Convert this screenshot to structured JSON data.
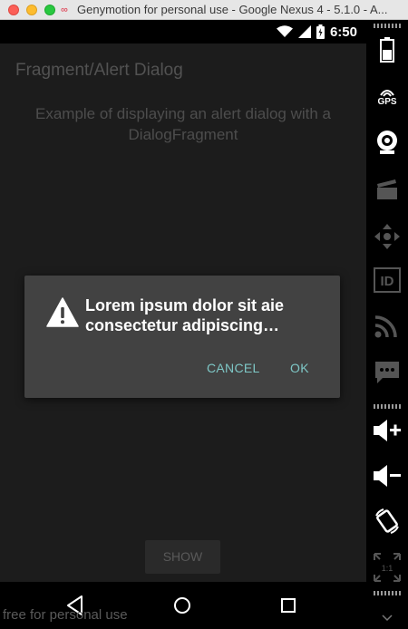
{
  "window": {
    "title": "Genymotion for personal use - Google Nexus 4 - 5.1.0 - A..."
  },
  "status_bar": {
    "time": "6:50",
    "icons": [
      "wifi-icon",
      "signal-icon",
      "battery-charging-icon"
    ]
  },
  "app": {
    "title": "Fragment/Alert Dialog",
    "description": "Example of displaying an alert dialog with a DialogFragment",
    "show_button": "SHOW"
  },
  "dialog": {
    "icon": "warning-icon",
    "message": "Lorem ipsum dolor sit aie consectetur adipiscing…",
    "cancel_label": "CANCEL",
    "ok_label": "OK",
    "accent_color": "#7ec7c6"
  },
  "nav_bar": {
    "buttons": [
      "back-icon",
      "home-icon",
      "recents-icon"
    ],
    "watermark": "free for personal use"
  },
  "sidebar": {
    "gps_label": "GPS",
    "id_label": "ID",
    "pixel_label": "1:1",
    "tools": [
      "battery",
      "gps",
      "camera",
      "video-capture",
      "dpad",
      "device-id",
      "network",
      "sms",
      "volume-up",
      "volume-down",
      "rotate",
      "pixel-perfect"
    ]
  }
}
